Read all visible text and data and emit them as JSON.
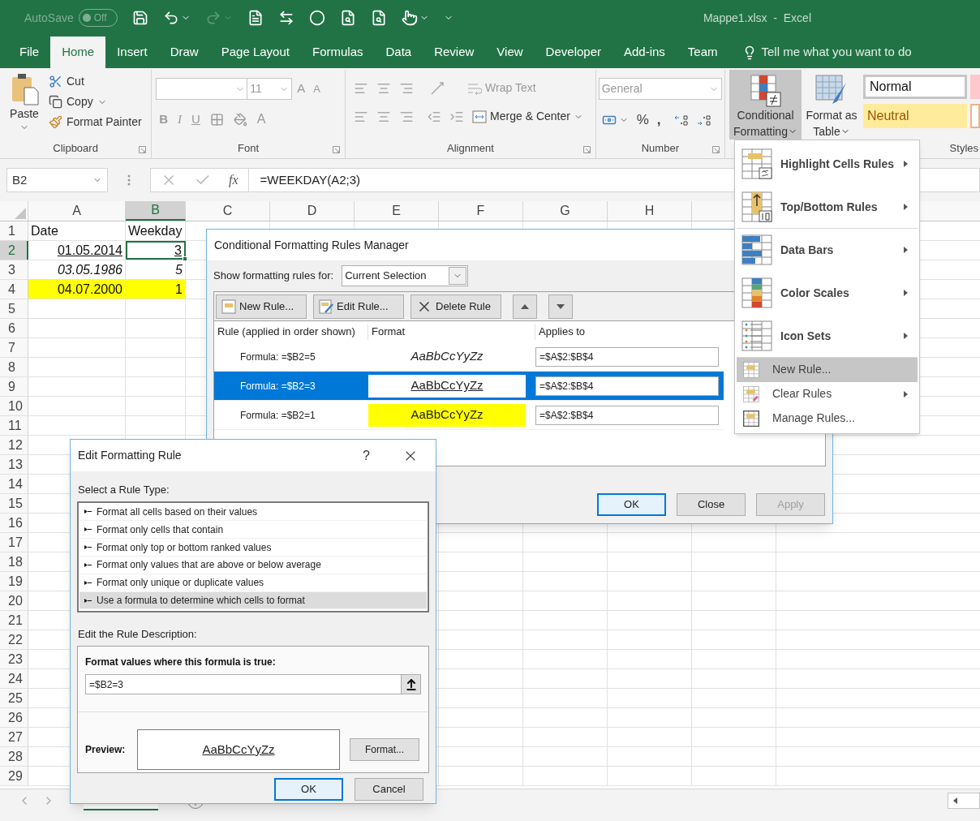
{
  "title_bar": {
    "autosave": {
      "label": "AutoSave",
      "toggle": "Off",
      "on": false
    },
    "title": "Mappe1.xlsx  -  Excel"
  },
  "tabs": [
    {
      "label": "File",
      "selected": false
    },
    {
      "label": "Home",
      "selected": true
    },
    {
      "label": "Insert",
      "selected": false
    },
    {
      "label": "Draw",
      "selected": false
    },
    {
      "label": "Page Layout",
      "selected": false
    },
    {
      "label": "Formulas",
      "selected": false
    },
    {
      "label": "Data",
      "selected": false
    },
    {
      "label": "Review",
      "selected": false
    },
    {
      "label": "View",
      "selected": false
    },
    {
      "label": "Developer",
      "selected": false
    },
    {
      "label": "Add-ins",
      "selected": false
    },
    {
      "label": "Team",
      "selected": false
    }
  ],
  "tell_me": "Tell me what you want to do",
  "ribbon": {
    "clipboard": {
      "paste": "Paste",
      "cut": "Cut",
      "copy": "Copy",
      "format_painter": "Format Painter",
      "label": "Clipboard"
    },
    "font": {
      "font_size": "11",
      "grow": "A",
      "shrink": "A",
      "bold": "B",
      "italic": "I",
      "underline": "U",
      "font_color": "A",
      "label": "Font"
    },
    "alignment": {
      "wrap_text": "Wrap Text",
      "merge": "Merge & Center",
      "label": "Alignment"
    },
    "number": {
      "format": "General",
      "percent": "%",
      "comma": ",",
      "label": "Number"
    },
    "styles": {
      "conditional_formatting": {
        "lines": [
          "Conditional",
          "Formatting"
        ],
        "pressed": true
      },
      "format_as_table": [
        "Format as",
        "Table"
      ],
      "cell_styles": [
        {
          "label": "Normal",
          "kind": "normal"
        },
        {
          "label": "Neutral",
          "kind": "neutral"
        }
      ],
      "label": "Styles"
    }
  },
  "formula_bar": {
    "name_box": "B2",
    "fx": "fx",
    "formula": "=WEEKDAY(A2;3)"
  },
  "sheet": {
    "columns": [
      {
        "label": "A",
        "selected": false
      },
      {
        "label": "B",
        "selected": true
      },
      {
        "label": "C",
        "selected": false
      },
      {
        "label": "D",
        "selected": false
      },
      {
        "label": "E",
        "selected": false
      },
      {
        "label": "F",
        "selected": false
      },
      {
        "label": "G",
        "selected": false
      },
      {
        "label": "H",
        "selected": false
      }
    ],
    "rows": [
      {
        "label": "1",
        "selected": false,
        "cells": [
          {
            "text": "Date",
            "kind": "label",
            "selected": false
          },
          {
            "text": "Weekday",
            "kind": "label",
            "selected": false
          }
        ]
      },
      {
        "label": "2",
        "selected": true,
        "cells": [
          {
            "text": "01.05.2014",
            "kind": "underlined",
            "selected": false
          },
          {
            "text": "3",
            "kind": "underlined",
            "selected": true
          }
        ]
      },
      {
        "label": "3",
        "selected": false,
        "cells": [
          {
            "text": "03.05.1986",
            "kind": "italic",
            "selected": false
          },
          {
            "text": "5",
            "kind": "italic",
            "selected": false
          }
        ]
      },
      {
        "label": "4",
        "selected": false,
        "cells": [
          {
            "text": "04.07.2000",
            "kind": "highlighted",
            "selected": false
          },
          {
            "text": "1",
            "kind": "highlighted",
            "selected": false
          }
        ]
      },
      {
        "label": "5",
        "selected": false
      },
      {
        "label": "6",
        "selected": false
      },
      {
        "label": "7",
        "selected": false
      },
      {
        "label": "8",
        "selected": false
      },
      {
        "label": "9",
        "selected": false
      },
      {
        "label": "10",
        "selected": false
      },
      {
        "label": "11",
        "selected": false
      },
      {
        "label": "12",
        "selected": false
      },
      {
        "label": "13",
        "selected": false
      },
      {
        "label": "14",
        "selected": false
      },
      {
        "label": "15",
        "selected": false
      },
      {
        "label": "16",
        "selected": false
      },
      {
        "label": "17",
        "selected": false
      },
      {
        "label": "18",
        "selected": false
      },
      {
        "label": "19",
        "selected": false
      },
      {
        "label": "20",
        "selected": false
      },
      {
        "label": "21",
        "selected": false
      },
      {
        "label": "22",
        "selected": false
      },
      {
        "label": "23",
        "selected": false
      },
      {
        "label": "24",
        "selected": false
      },
      {
        "label": "25",
        "selected": false
      },
      {
        "label": "26",
        "selected": false
      },
      {
        "label": "27",
        "selected": false
      },
      {
        "label": "28",
        "selected": false
      },
      {
        "label": "29",
        "selected": false
      }
    ]
  },
  "rules_manager": {
    "title": "Conditional Formatting Rules Manager",
    "show_for_label": "Show formatting rules for:",
    "show_for": "Current Selection",
    "toolbar": [
      {
        "label": "New Rule...",
        "kind": "new"
      },
      {
        "label": "Edit Rule...",
        "kind": "edit"
      },
      {
        "label": "Delete Rule",
        "kind": "delete"
      }
    ],
    "columns": [
      "Rule (applied in order shown)",
      "Format",
      "Applies to"
    ],
    "rules": [
      {
        "rule": "Formula: =$B2=5",
        "preview": "AaBbCcYyZz",
        "kind": "italic",
        "applies_to": "=$A$2:$B$4",
        "selected": false
      },
      {
        "rule": "Formula: =$B2=3",
        "preview": "AaBbCcYyZz",
        "kind": "underlined",
        "applies_to": "=$A$2:$B$4",
        "selected": true
      },
      {
        "rule": "Formula: =$B2=1",
        "preview": "AaBbCcYyZz",
        "kind": "highlighted",
        "applies_to": "=$A$2:$B$4",
        "selected": false
      }
    ],
    "buttons": [
      {
        "label": "OK",
        "default": true,
        "disabled": false
      },
      {
        "label": "Close",
        "default": false,
        "disabled": false
      },
      {
        "label": "Apply",
        "default": false,
        "disabled": true
      }
    ]
  },
  "cf_menu": {
    "items": [
      {
        "label": "Highlight Cells Rules",
        "kind": "large",
        "submenu": true,
        "selected": false,
        "separator_after": false
      },
      {
        "label": "Top/Bottom Rules",
        "kind": "large",
        "submenu": true,
        "selected": false,
        "separator_after": true
      },
      {
        "label": "Data Bars",
        "kind": "large",
        "submenu": true,
        "selected": false,
        "separator_after": false
      },
      {
        "label": "Color Scales",
        "kind": "large",
        "submenu": true,
        "selected": false,
        "separator_after": false
      },
      {
        "label": "Icon Sets",
        "kind": "large",
        "submenu": true,
        "selected": false,
        "separator_after": true
      },
      {
        "label": "New Rule...",
        "kind": "small",
        "submenu": false,
        "selected": true,
        "separator_after": false
      },
      {
        "label": "Clear Rules",
        "kind": "small",
        "submenu": true,
        "selected": false,
        "separator_after": false
      },
      {
        "label": "Manage Rules...",
        "kind": "small",
        "submenu": false,
        "selected": false,
        "separator_after": false
      }
    ]
  },
  "edit_rule": {
    "title": "Edit Formatting Rule",
    "help": "?",
    "select_label": "Select a Rule Type:",
    "rule_types": [
      {
        "label": "Format all cells based on their values",
        "selected": false
      },
      {
        "label": "Format only cells that contain",
        "selected": false
      },
      {
        "label": "Format only top or bottom ranked values",
        "selected": false
      },
      {
        "label": "Format only values that are above or below average",
        "selected": false
      },
      {
        "label": "Format only unique or duplicate values",
        "selected": false
      },
      {
        "label": "Use a formula to determine which cells to format",
        "selected": true
      }
    ],
    "description_label": "Edit the Rule Description:",
    "formula_label": "Format values where this formula is true:",
    "formula": "=$B2=3",
    "preview_label": "Preview:",
    "preview": "AaBbCcYyZz",
    "format_button": "Format...",
    "buttons": [
      {
        "label": "OK",
        "default": true
      },
      {
        "label": "Cancel",
        "default": false
      }
    ]
  }
}
